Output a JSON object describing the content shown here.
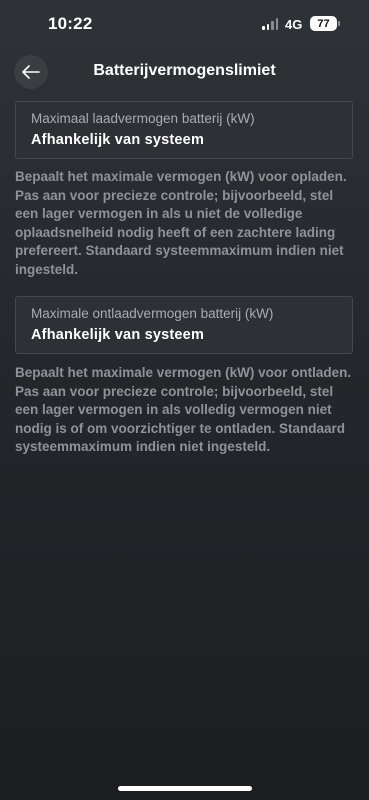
{
  "status_bar": {
    "time": "10:22",
    "network": "4G",
    "battery_level": "77"
  },
  "header": {
    "title": "Batterijvermogenslimiet",
    "back_icon": "arrow-left-icon"
  },
  "fields": [
    {
      "label": "Maximaal laadvermogen batterij (kW)",
      "value": "Afhankelijk van systeem",
      "help": "Bepaalt het maximale vermogen (kW) voor opladen. Pas aan voor precieze controle; bijvoorbeeld, stel een lager vermogen in als u niet de volledige oplaadsnelheid nodig heeft of een zachtere lading prefereert. Standaard systeemmaximum indien niet ingesteld."
    },
    {
      "label": "Maximale ontlaadvermogen batterij (kW)",
      "value": "Afhankelijk van systeem",
      "help": "Bepaalt het maximale vermogen (kW) voor ontladen. Pas aan voor precieze controle; bijvoorbeeld, stel een lager vermogen in als volledig vermogen niet nodig is of om voorzichtiger te ontladen. Standaard systeemmaximum indien niet ingesteld."
    }
  ]
}
